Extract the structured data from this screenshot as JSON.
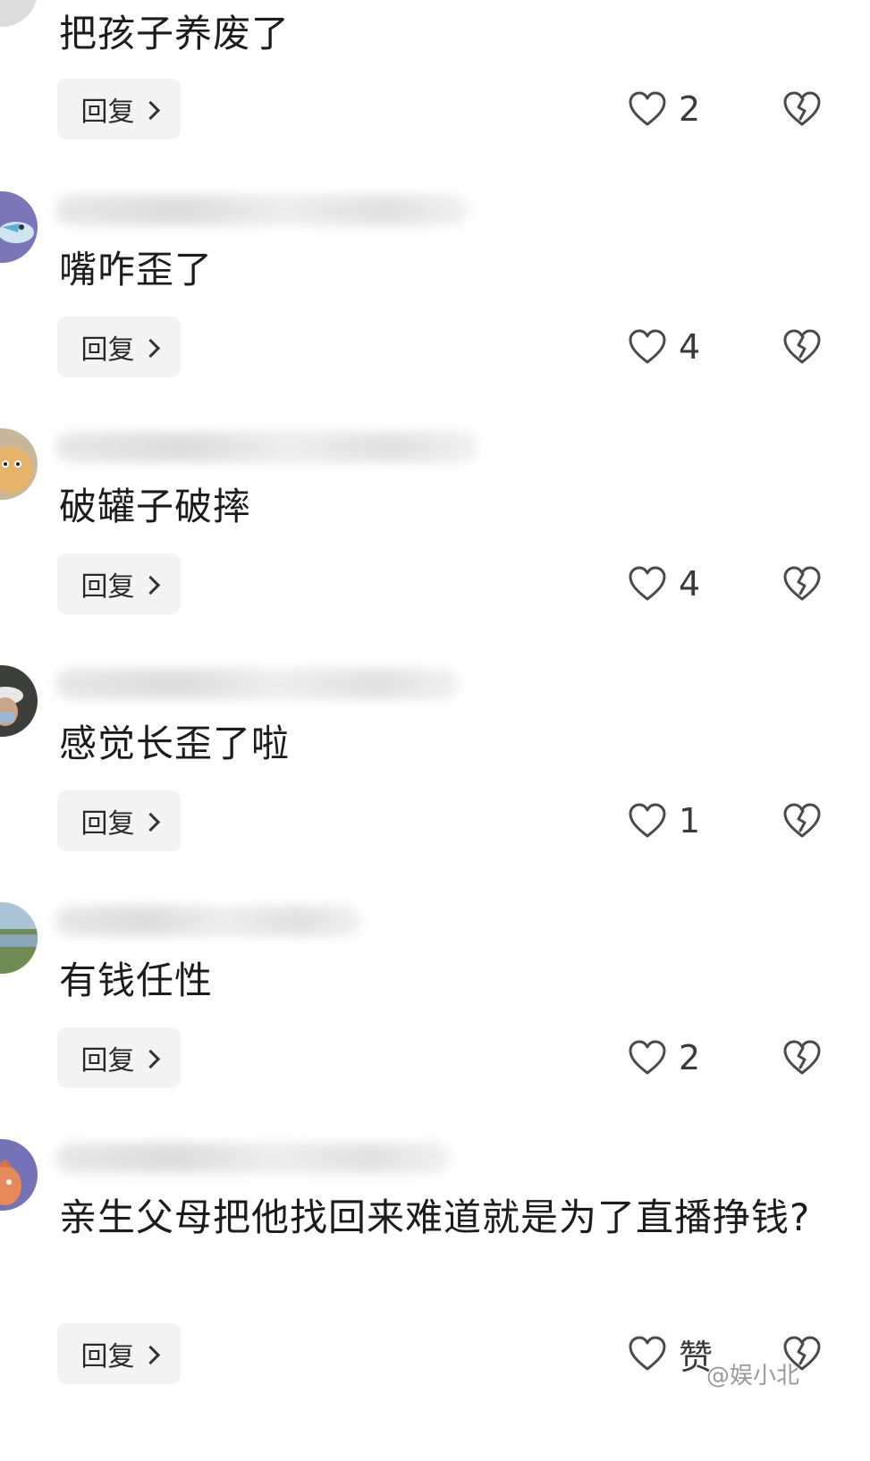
{
  "comments": [
    {
      "text": "把孩子养废了",
      "reply_label": "回复",
      "likes": "2"
    },
    {
      "text": "嘴咋歪了",
      "reply_label": "回复",
      "likes": "4"
    },
    {
      "text": "破罐子破摔",
      "reply_label": "回复",
      "likes": "4"
    },
    {
      "text": "感觉长歪了啦",
      "reply_label": "回复",
      "likes": "1"
    },
    {
      "text": "有钱任性",
      "reply_label": "回复",
      "likes": "2"
    },
    {
      "text": "亲生父母把他找回来难道就是为了直播挣钱?",
      "reply_label": "回复",
      "likes": "赞"
    }
  ],
  "watermark": "@娱小北",
  "colors": {
    "reply_bg": "#f3f3f3",
    "text": "#1c1c1c",
    "icon": "#4a4a4a"
  }
}
